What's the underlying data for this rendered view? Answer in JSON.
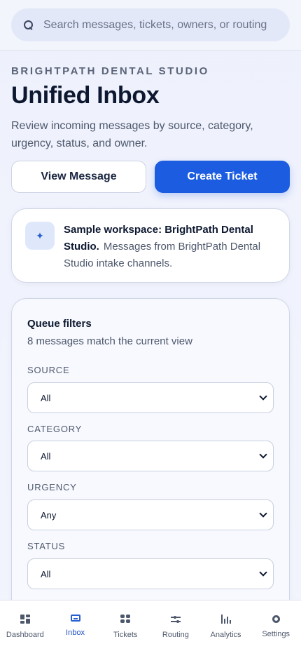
{
  "search": {
    "placeholder": "Search messages, tickets, owners, or routing r"
  },
  "header": {
    "eyebrow": "BRIGHTPATH DENTAL STUDIO",
    "title": "Unified Inbox",
    "subtitle": "Review incoming messages by source, category, urgency, status, and owner."
  },
  "actions": {
    "view_label": "View Message",
    "create_label": "Create Ticket"
  },
  "notice": {
    "icon": "sparkle-icon",
    "title": "Sample workspace: BrightPath Dental Studio.",
    "body": "Messages from BrightPath Dental Studio intake channels."
  },
  "filters": {
    "title": "Queue filters",
    "count_text": "8 messages match the current view",
    "source": {
      "label": "SOURCE",
      "value": "All"
    },
    "category": {
      "label": "CATEGORY",
      "value": "All"
    },
    "urgency": {
      "label": "URGENCY",
      "value": "Any"
    },
    "status": {
      "label": "STATUS",
      "value": "All"
    }
  },
  "nav": {
    "items": [
      {
        "label": "Dashboard",
        "icon": "dashboard-icon"
      },
      {
        "label": "Inbox",
        "icon": "inbox-icon",
        "active": true
      },
      {
        "label": "Tickets",
        "icon": "tickets-icon"
      },
      {
        "label": "Routing",
        "icon": "routing-icon"
      },
      {
        "label": "Analytics",
        "icon": "analytics-icon"
      },
      {
        "label": "Settings",
        "icon": "settings-icon"
      }
    ]
  },
  "colors": {
    "accent": "#1c5ce0",
    "active_nav": "#1c4fc4"
  }
}
